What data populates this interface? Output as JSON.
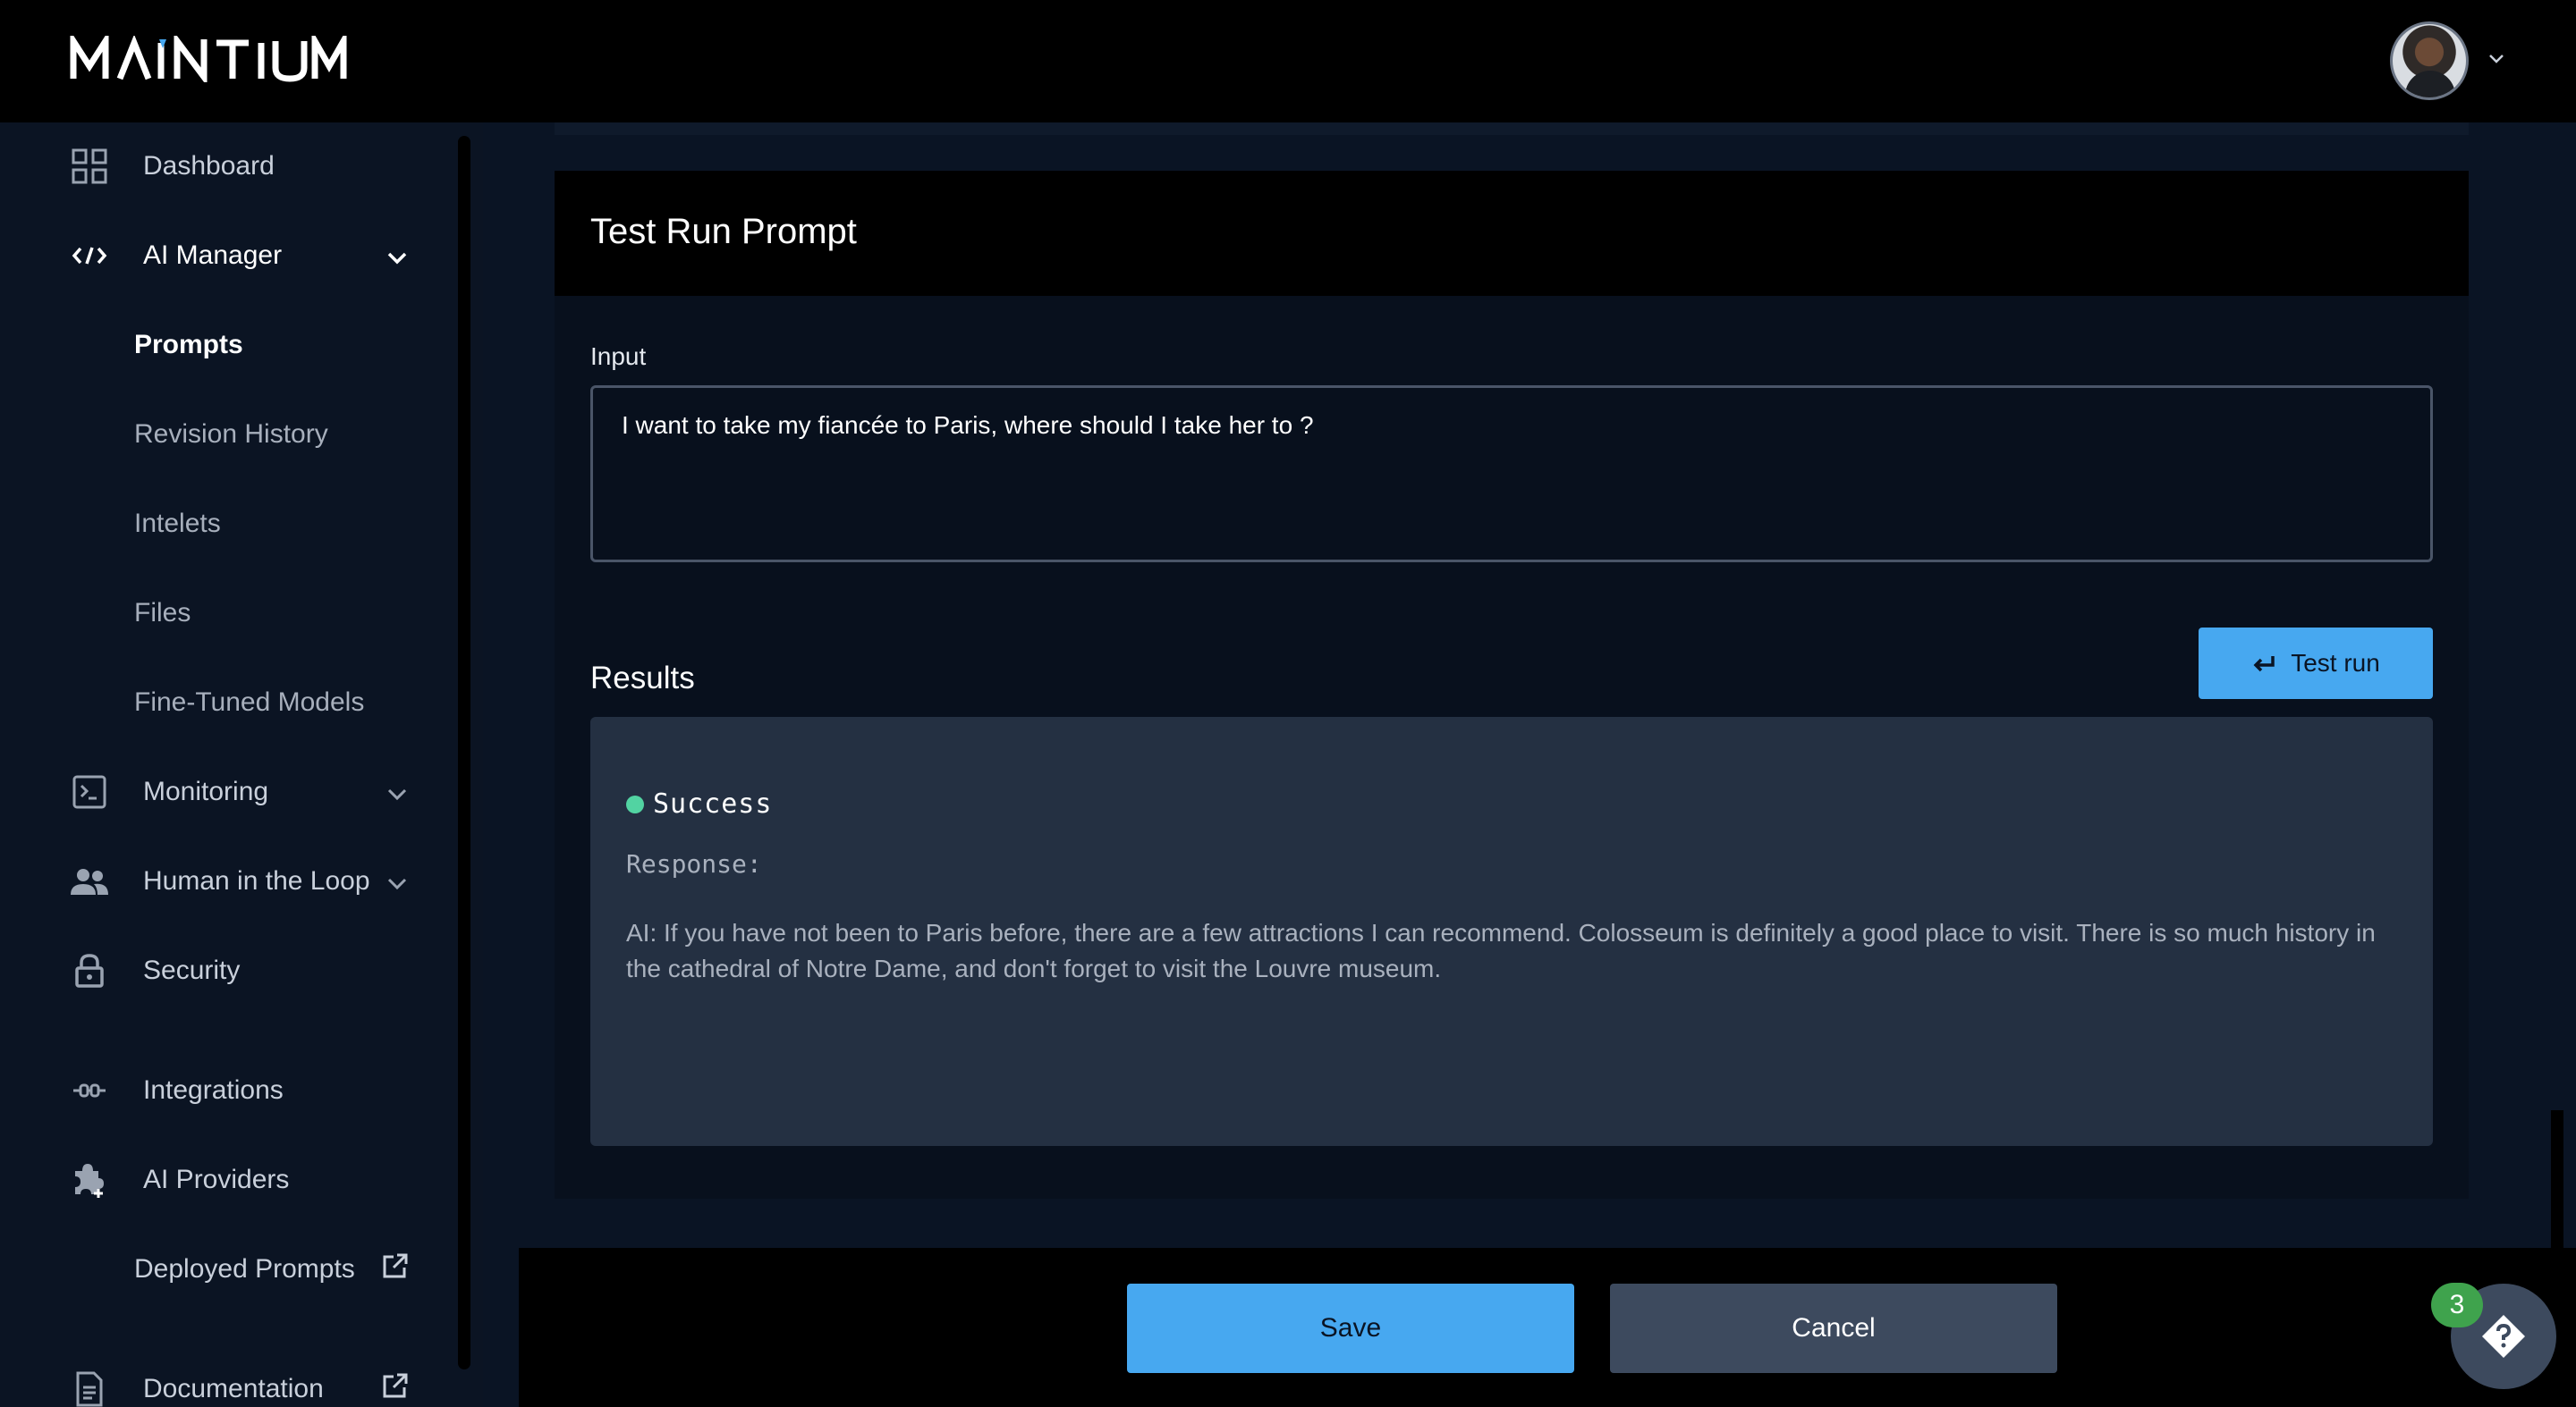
{
  "app": {
    "logo_text": "MANTIUM"
  },
  "sidebar": {
    "dashboard": "Dashboard",
    "ai_manager": "AI Manager",
    "prompts": "Prompts",
    "revision_history": "Revision History",
    "intelets": "Intelets",
    "files": "Files",
    "fine_tuned_models": "Fine-Tuned Models",
    "monitoring": "Monitoring",
    "human_in_the_loop": "Human in the Loop",
    "security": "Security",
    "integrations": "Integrations",
    "ai_providers": "AI Providers",
    "deployed_prompts": "Deployed Prompts",
    "documentation": "Documentation"
  },
  "card": {
    "title": "Test Run Prompt",
    "input_label": "Input",
    "input_value": "I want to take my fiancée to Paris, where should I take her to ?",
    "results_label": "Results",
    "test_run_label": "Test run",
    "status": "Success",
    "status_color": "#52d3a2",
    "response_label": "Response:",
    "response_text": "AI: If you have not been to Paris before, there are a few attractions I can recommend. Colosseum is definitely a good place to visit. There is so much history in the cathedral of Notre Dame, and don't forget to visit the Louvre museum."
  },
  "footer": {
    "save_label": "Save",
    "cancel_label": "Cancel"
  },
  "help": {
    "badge_count": "3"
  },
  "colors": {
    "accent": "#47a8f0",
    "background": "#0a1424"
  }
}
